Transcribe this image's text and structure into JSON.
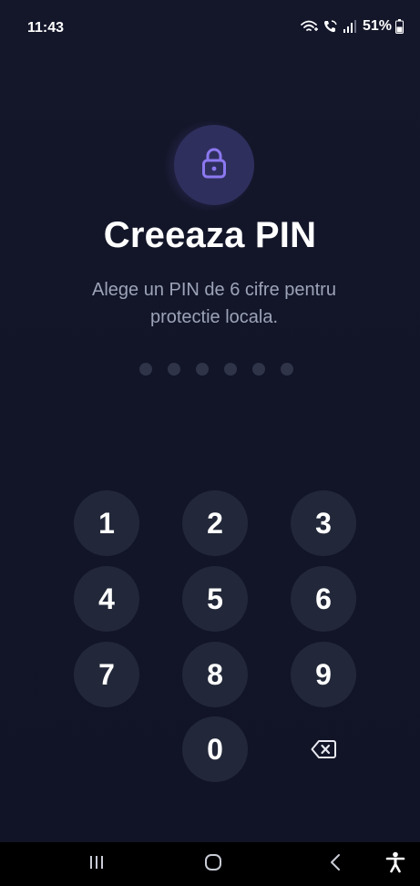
{
  "status_bar": {
    "time": "11:43",
    "battery": "51%"
  },
  "lock": {
    "icon": "lock-icon"
  },
  "title": "Creeaza PIN",
  "subtitle": "Alege un PIN de 6 cifre pentru protectie locala.",
  "pin": {
    "length": 6,
    "filled": 0
  },
  "keypad": {
    "keys": [
      "1",
      "2",
      "3",
      "4",
      "5",
      "6",
      "7",
      "8",
      "9",
      "0"
    ],
    "backspace_icon": "backspace-icon"
  },
  "nav_bar": {
    "recents_icon": "recents-icon",
    "home_icon": "home-icon",
    "back_icon": "back-icon",
    "accessibility_icon": "accessibility-icon"
  },
  "colors": {
    "background": "#13162a",
    "accent": "#8b78f0",
    "key_background": "#222839",
    "dot_inactive": "#2f3449",
    "subtitle": "#9da3b8"
  }
}
